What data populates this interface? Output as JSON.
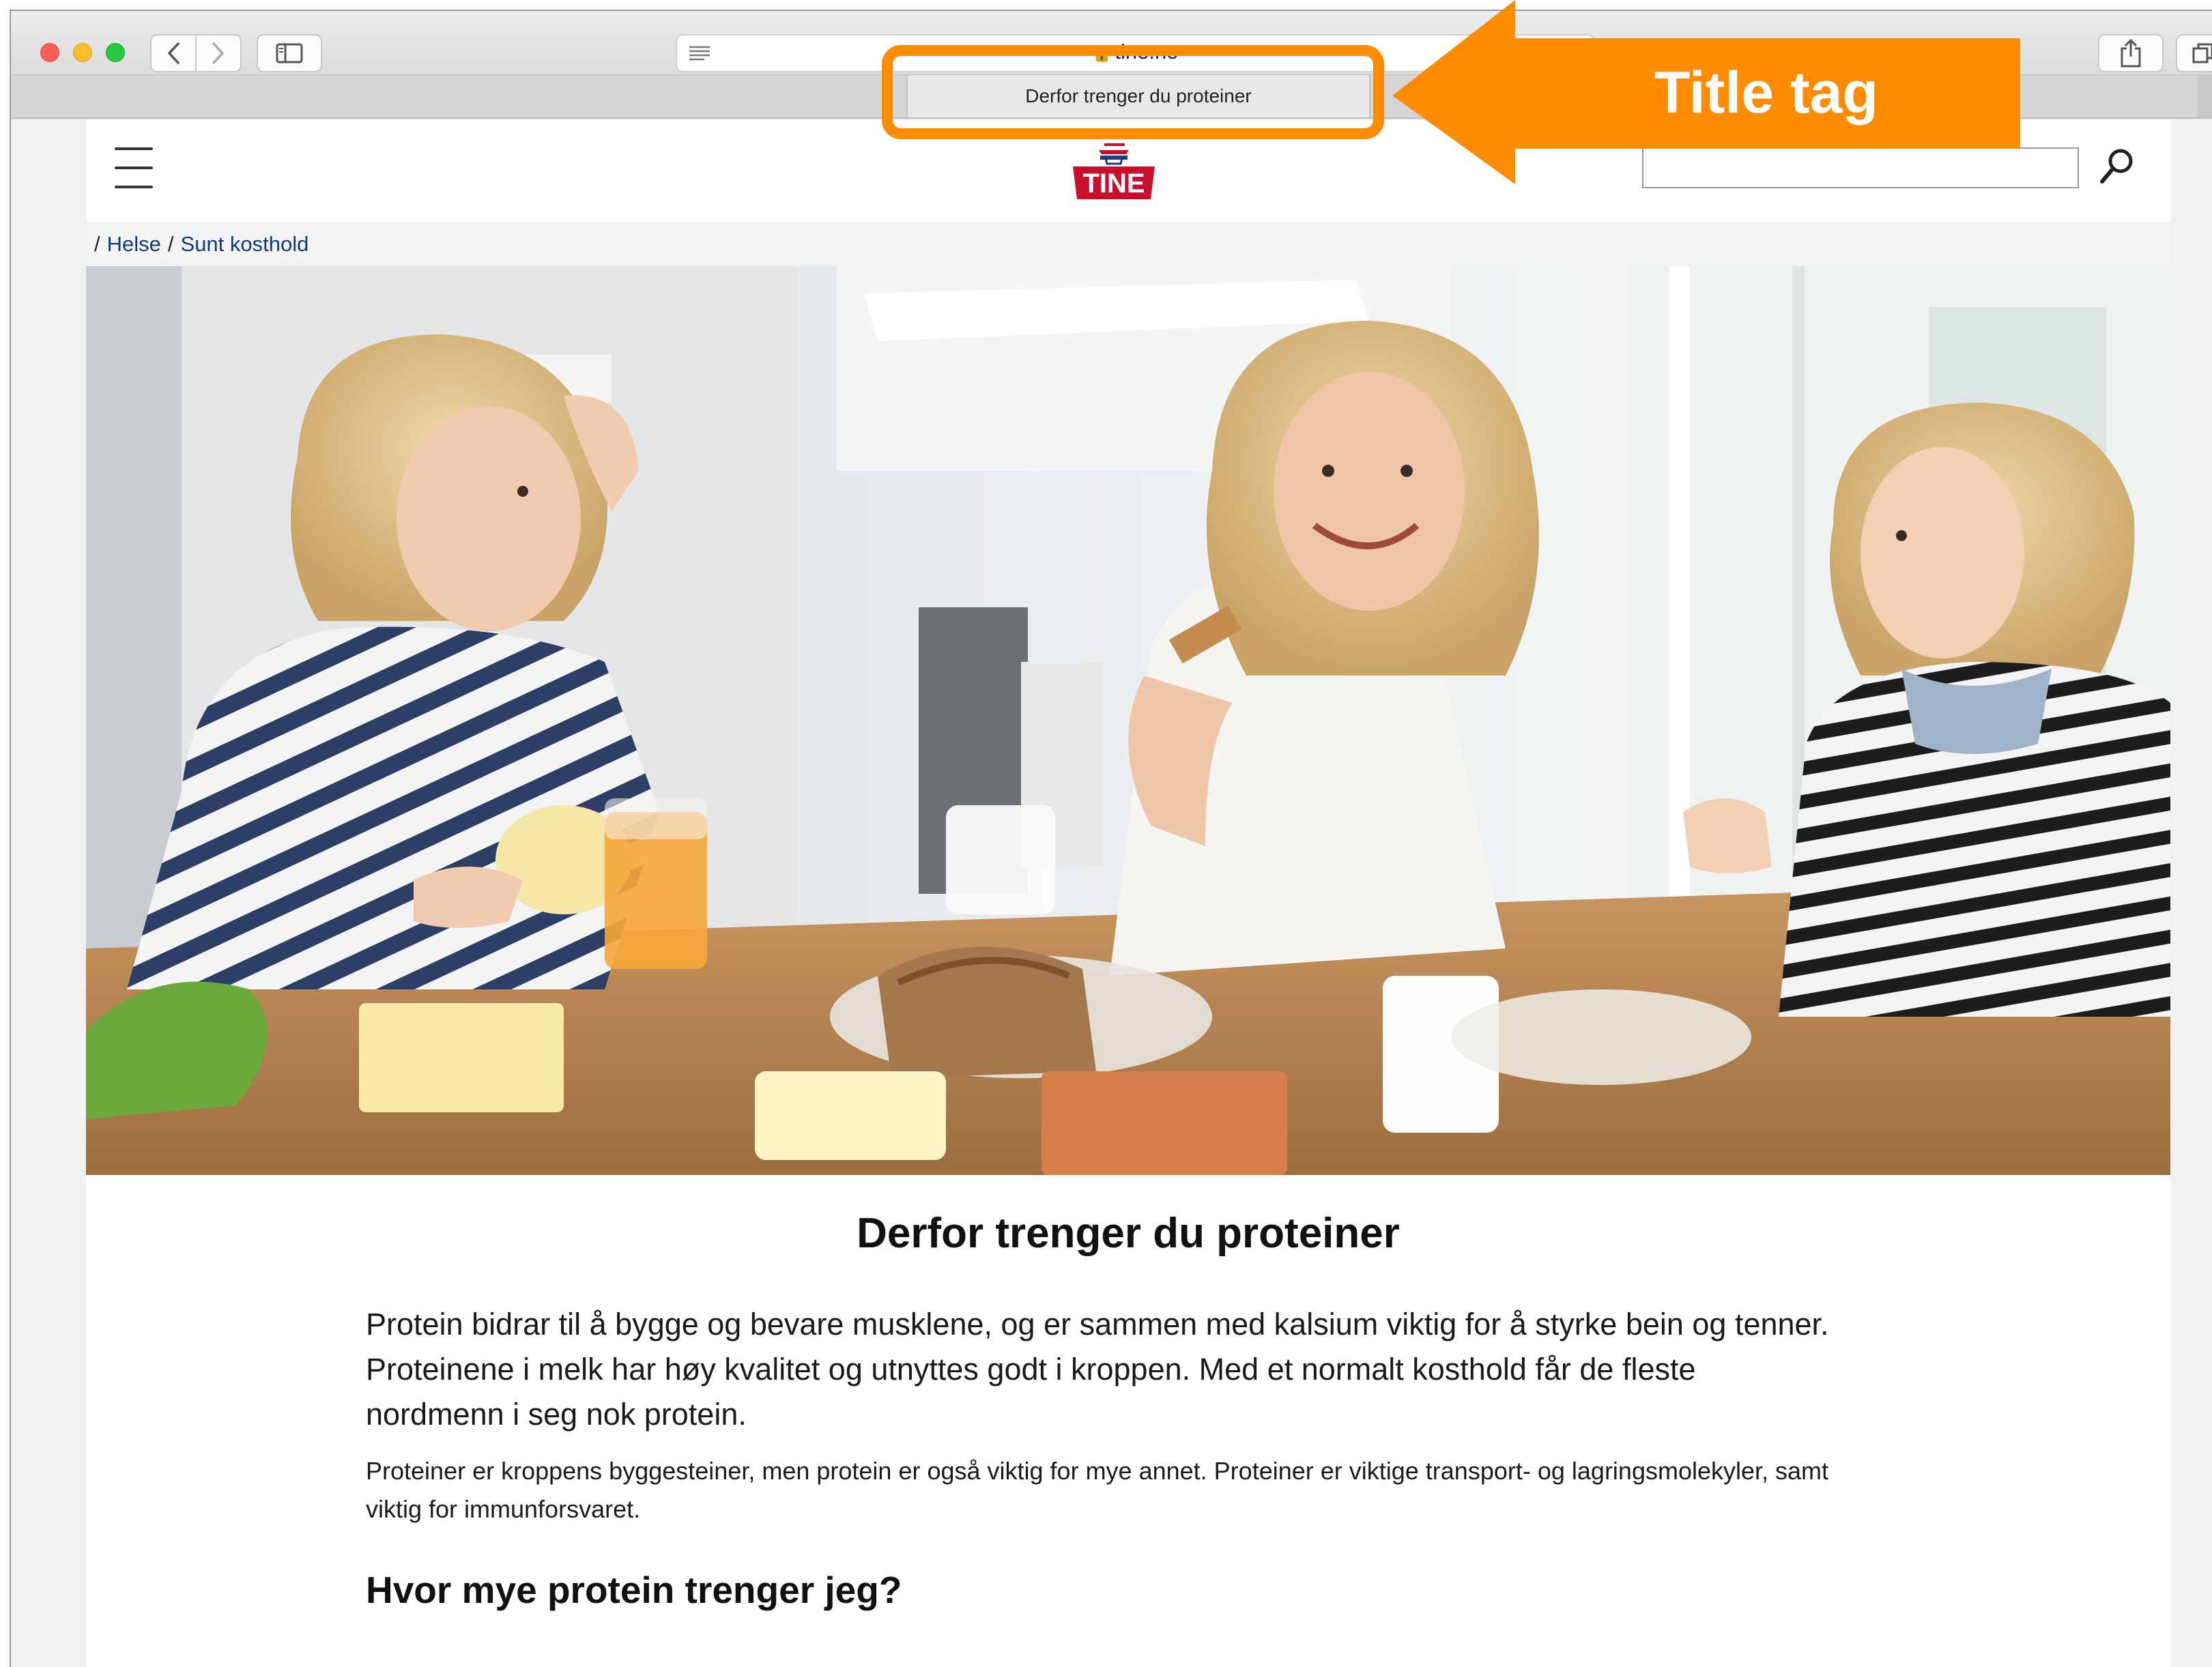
{
  "browser": {
    "url": "tine.no",
    "tab_title": "Derfor trenger du proteiner"
  },
  "annotation": {
    "label": "Title tag",
    "color": "#ff8c00"
  },
  "site": {
    "logo_text": "TINE",
    "breadcrumb": [
      "Helse",
      "Sunt kosthold"
    ],
    "search_placeholder": ""
  },
  "article": {
    "title": "Derfor trenger du proteiner",
    "lead": "Protein bidrar til å bygge og bevare musklene, og er sammen med kalsium viktig for å styrke bein og tenner. Proteinene i melk har høy kvalitet og utnyttes godt i kroppen. Med et normalt kosthold får de fleste nordmenn i seg nok protein.",
    "body": "Proteiner er kroppens byggesteiner, men protein er også viktig for mye annet. Proteiner er viktige transport- og lagringsmolekyler, samt viktig for immunforsvaret.",
    "subheading": "Hvor mye protein trenger jeg?"
  },
  "icons": {
    "back": "chevron-left-icon",
    "forward": "chevron-right-icon",
    "sidebar": "sidebar-icon",
    "reader": "reader-icon",
    "lock": "lock-icon",
    "share": "share-icon",
    "tabs": "tabs-icon",
    "menu": "hamburger-icon",
    "search": "search-icon"
  }
}
